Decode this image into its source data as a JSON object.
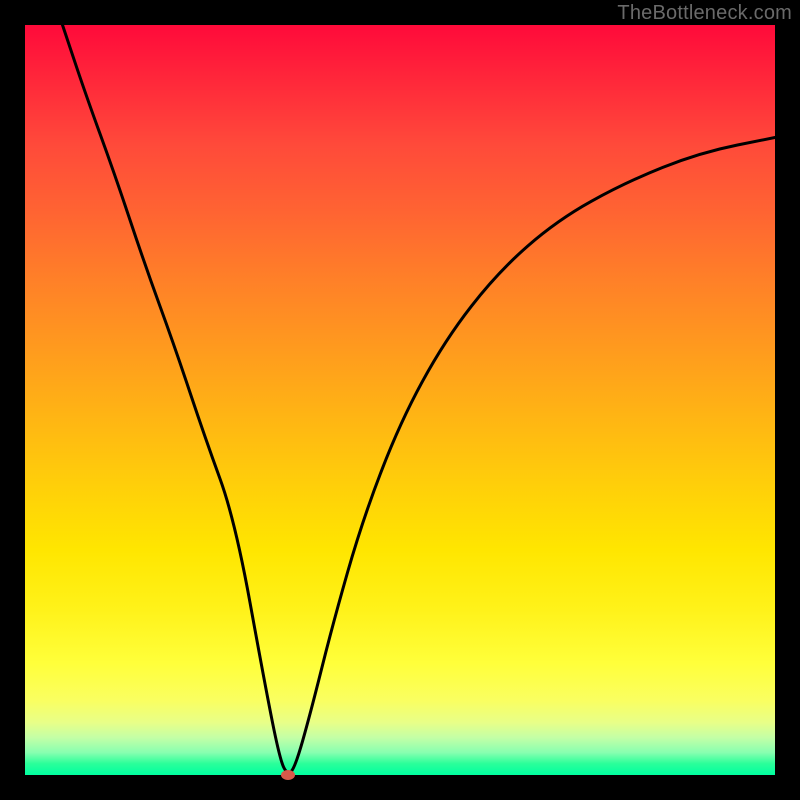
{
  "watermark": "TheBottleneck.com",
  "colors": {
    "background": "#000000",
    "curve": "#000000",
    "marker": "#d85a4a"
  },
  "chart_data": {
    "type": "line",
    "title": "",
    "xlabel": "",
    "ylabel": "",
    "xlim": [
      0,
      100
    ],
    "ylim": [
      0,
      100
    ],
    "grid": false,
    "legend": false,
    "note": "No axis ticks or labels are visible in the source image; values are normalized 0-100 in both axes. Curve descends steeply from top-left to a minimum near x≈35 at the bottom, then rises with decreasing slope toward the right.",
    "series": [
      {
        "name": "curve",
        "x": [
          5,
          8,
          12,
          16,
          20,
          24,
          28,
          32,
          34,
          35,
          36,
          38,
          41,
          45,
          50,
          56,
          63,
          71,
          80,
          90,
          100
        ],
        "y": [
          100,
          91,
          80,
          68,
          57,
          45,
          34,
          12,
          2,
          0,
          1,
          8,
          20,
          34,
          47,
          58,
          67,
          74,
          79,
          83,
          85
        ]
      }
    ],
    "marker": {
      "x": 35,
      "y": 0
    },
    "background_gradient": {
      "direction": "vertical",
      "stops": [
        {
          "pos": 0.0,
          "color": "#ff0a3a"
        },
        {
          "pos": 0.25,
          "color": "#ff6432"
        },
        {
          "pos": 0.52,
          "color": "#ffb414"
        },
        {
          "pos": 0.78,
          "color": "#fff21a"
        },
        {
          "pos": 0.93,
          "color": "#e8ff88"
        },
        {
          "pos": 1.0,
          "color": "#00ffa0"
        }
      ]
    }
  }
}
